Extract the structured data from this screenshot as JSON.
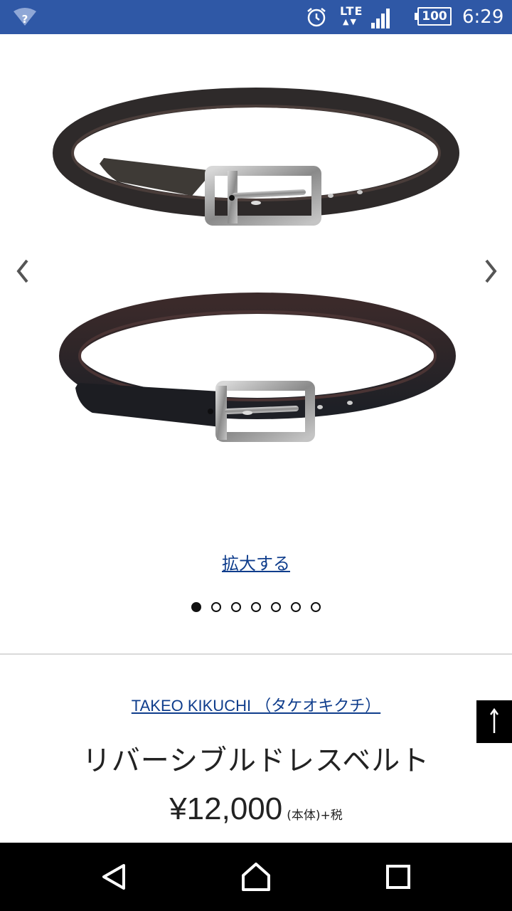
{
  "status_bar": {
    "time": "6:29",
    "battery": "100",
    "network": "LTE",
    "wifi_badge": "?"
  },
  "product": {
    "zoom_label": "拡大する",
    "image_count": 7,
    "current_image_index": 0,
    "brand": "TAKEO KIKUCHI （タケオキクチ）",
    "name": "リバーシブルドレスベルト",
    "price": "¥12,000",
    "price_note": "(本体)+税"
  },
  "icons": {
    "prev": "chevron-left-icon",
    "next": "chevron-right-icon",
    "to_top": "arrow-up-icon",
    "nav_back": "triangle-back-icon",
    "nav_home": "home-icon",
    "nav_recent": "square-recent-icon"
  },
  "colors": {
    "status_bar": "#2f58a6",
    "link": "#0f3d8c",
    "text": "#222222"
  }
}
